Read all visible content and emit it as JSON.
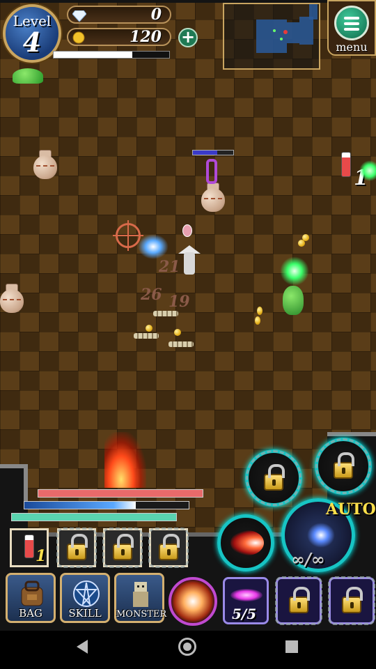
{
  "hud": {
    "level_label": "Level",
    "level_value": "4",
    "gems": "0",
    "gold": "120",
    "xp_fraction": 0.68,
    "menu_label": "menu"
  },
  "bars": {
    "hp_fraction": 1.0,
    "mp_fraction": 0.68,
    "sp_fraction": 1.0
  },
  "field": {
    "damage_numbers": [
      "21",
      "26",
      "19"
    ],
    "pickup_count": "1"
  },
  "quick_items": {
    "potion_count": "1"
  },
  "skills": {
    "auto_label": "AUTO",
    "infinity_label": "∞/∞"
  },
  "bottom_menu": {
    "bag": "BAG",
    "skill": "SKILL",
    "monster": "MONSTER",
    "charges": "5/5"
  },
  "colors": {
    "hp": "#e86a6a",
    "mp": "#3a8ad8",
    "sp": "#5ad4b0",
    "accent_cyan": "#17c4c4",
    "frame_gold": "#c9a560"
  },
  "icons": [
    "diamond-icon",
    "gold-coin-icon",
    "plus-icon",
    "hamburger-icon",
    "lock-icon",
    "bag-icon",
    "pentagram-icon",
    "monster-icon",
    "fireball-icon",
    "magic-missile-icon",
    "back-icon",
    "home-icon",
    "recent-apps-icon"
  ]
}
